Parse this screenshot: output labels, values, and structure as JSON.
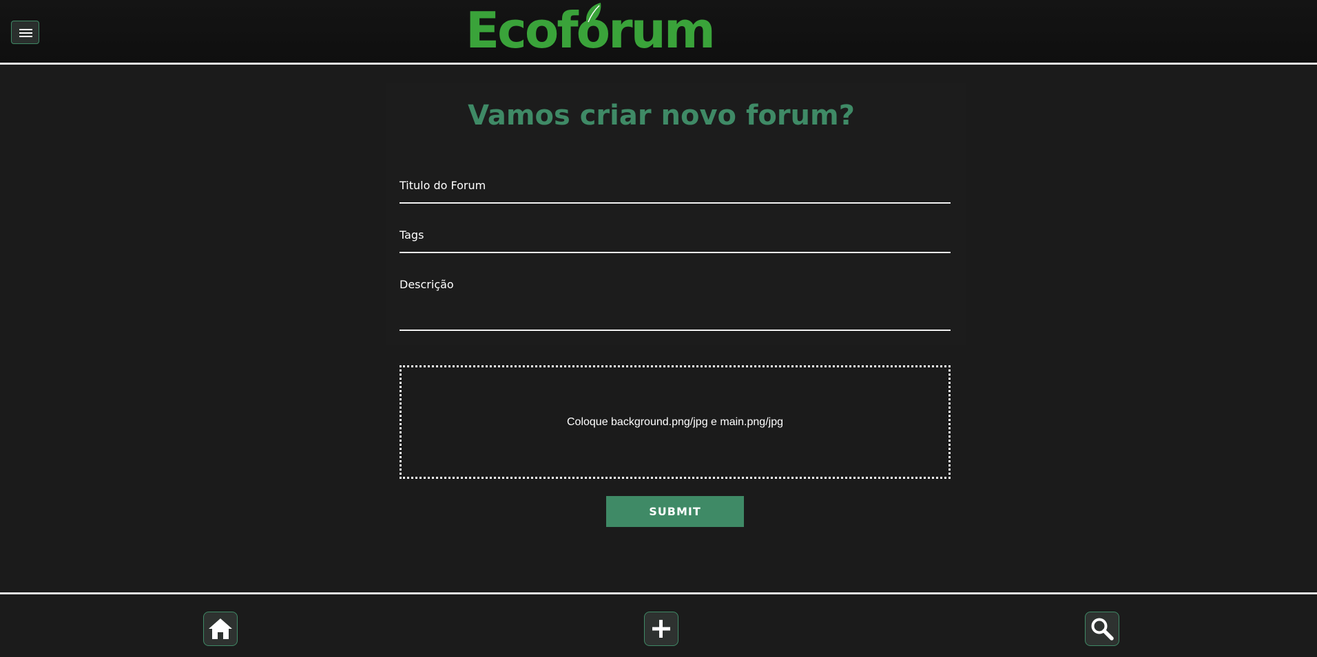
{
  "header": {
    "brand_name": "Ecoforum",
    "menu_icon": "hamburger-menu-icon"
  },
  "page": {
    "title": "Vamos criar novo forum?"
  },
  "form": {
    "title_label": "Titulo do Forum",
    "tags_label": "Tags",
    "description_label": "Descrição",
    "upload_text": "Coloque background.png/jpg e main.png/jpg",
    "submit_label": "SUBMIT"
  },
  "bottom_nav": {
    "home_icon": "home-icon",
    "add_icon": "plus-icon",
    "search_icon": "search-icon"
  },
  "colors": {
    "accent": "#3f8a66",
    "logo_green": "#3aa33a",
    "background": "#1b1b1b"
  }
}
